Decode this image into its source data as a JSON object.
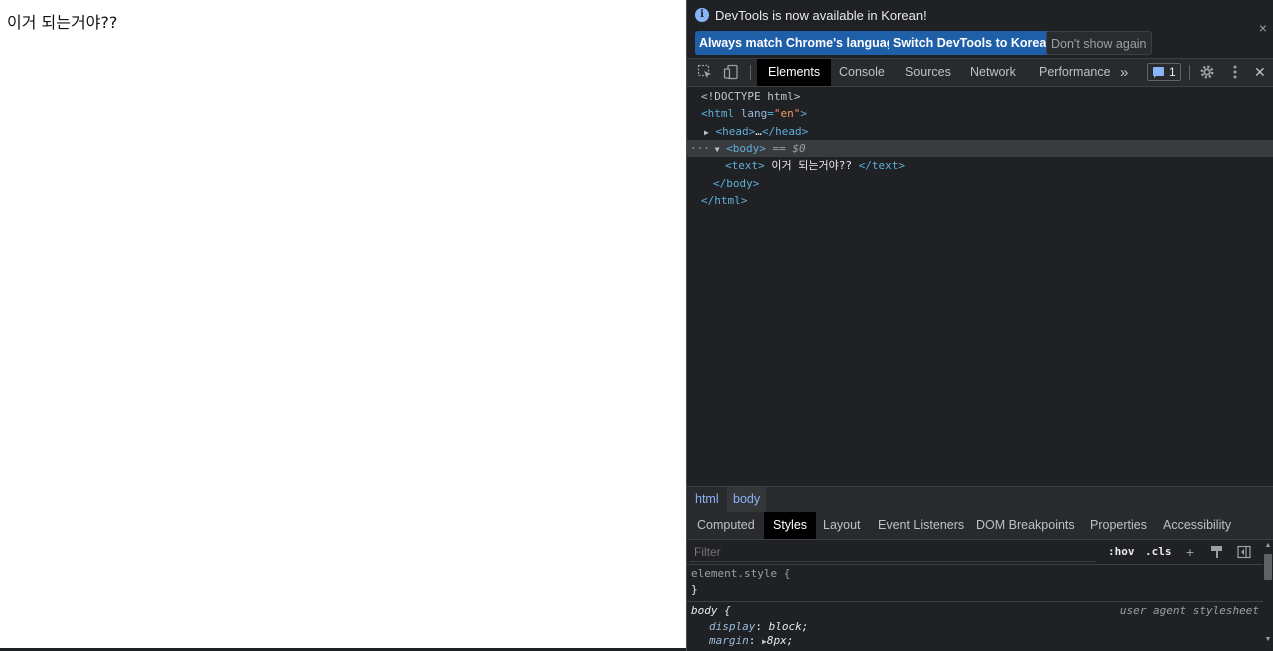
{
  "page": {
    "text": "이거 되는거야??"
  },
  "infobar": {
    "message": "DevTools is now available in Korean!",
    "info_icon": "i",
    "close_label": "×",
    "buttons": {
      "match": "Always match Chrome's language",
      "switch": "Switch DevTools to Korean",
      "dont_show": "Don't show again"
    }
  },
  "toolbar": {
    "tabs": [
      "Elements",
      "Console",
      "Sources",
      "Network",
      "Performance"
    ],
    "active_tab": "Elements",
    "more_tabs_label": "»",
    "issues_count": "1",
    "close_label": "✕"
  },
  "tree": {
    "doctype": "<!DOCTYPE html>",
    "html_open_tag": "<html",
    "html_attr_name": "lang",
    "html_attr_value": "\"en\"",
    "head_open": "<head>",
    "head_ellipsis": "…",
    "head_close": "</head>",
    "body_open": "<body>",
    "body_marker": "== $0",
    "dots": "···",
    "text_open": "<text>",
    "text_content": " 이거 되는거야?? ",
    "text_close": "</text>",
    "body_close": "</body>",
    "html_close": "</html>"
  },
  "breadcrumbs": [
    "html",
    "body"
  ],
  "panel_tabs": [
    "Computed",
    "Styles",
    "Layout",
    "Event Listeners",
    "DOM Breakpoints",
    "Properties",
    "Accessibility"
  ],
  "active_panel_tab": "Styles",
  "filter": {
    "placeholder": "Filter",
    "hov": ":hov",
    "cls": ".cls"
  },
  "styles": {
    "element_style_selector": "element.style {",
    "element_style_close": "}",
    "body_selector": "body {",
    "body_origin": "user agent stylesheet",
    "props": [
      {
        "name": "display",
        "value": "block;"
      },
      {
        "name": "margin",
        "value": "8px;"
      }
    ]
  },
  "colors": {
    "devtools_bg": "#202124",
    "primary_button": "#1f5fa8",
    "tag": "#5db0d7",
    "attr_value": "#f29766"
  }
}
